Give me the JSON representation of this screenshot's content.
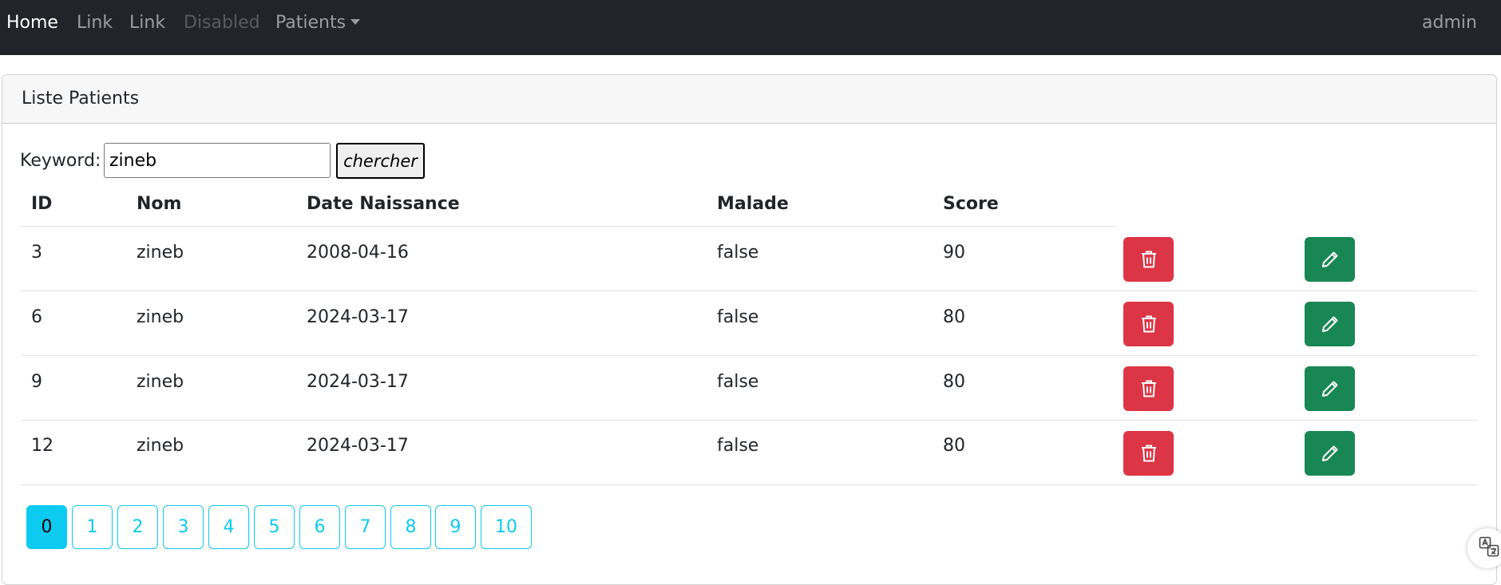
{
  "navbar": {
    "items": [
      {
        "label": "Home",
        "state": "active"
      },
      {
        "label": "Link",
        "state": "normal"
      },
      {
        "label": "Link",
        "state": "normal"
      },
      {
        "label": "Disabled",
        "state": "disabled"
      },
      {
        "label": "Patients",
        "state": "dropdown"
      }
    ],
    "user": "admin"
  },
  "card": {
    "title": "Liste Patients"
  },
  "search": {
    "label": "Keyword:",
    "value": "zineb",
    "button_label": "chercher"
  },
  "table": {
    "headers": [
      "ID",
      "Nom",
      "Date Naissance",
      "Malade",
      "Score"
    ],
    "rows": [
      {
        "id": "3",
        "nom": "zineb",
        "date": "2008-04-16",
        "malade": "false",
        "score": "90"
      },
      {
        "id": "6",
        "nom": "zineb",
        "date": "2024-03-17",
        "malade": "false",
        "score": "80"
      },
      {
        "id": "9",
        "nom": "zineb",
        "date": "2024-03-17",
        "malade": "false",
        "score": "80"
      },
      {
        "id": "12",
        "nom": "zineb",
        "date": "2024-03-17",
        "malade": "false",
        "score": "80"
      }
    ],
    "delete_icon": "trash-icon",
    "edit_icon": "pencil-icon"
  },
  "pagination": {
    "pages": [
      "0",
      "1",
      "2",
      "3",
      "4",
      "5",
      "6",
      "7",
      "8",
      "9",
      "10"
    ],
    "current": "0"
  },
  "colors": {
    "navbar_bg": "#212529",
    "danger": "#dc3545",
    "success": "#198754",
    "info": "#0dcaf0"
  }
}
